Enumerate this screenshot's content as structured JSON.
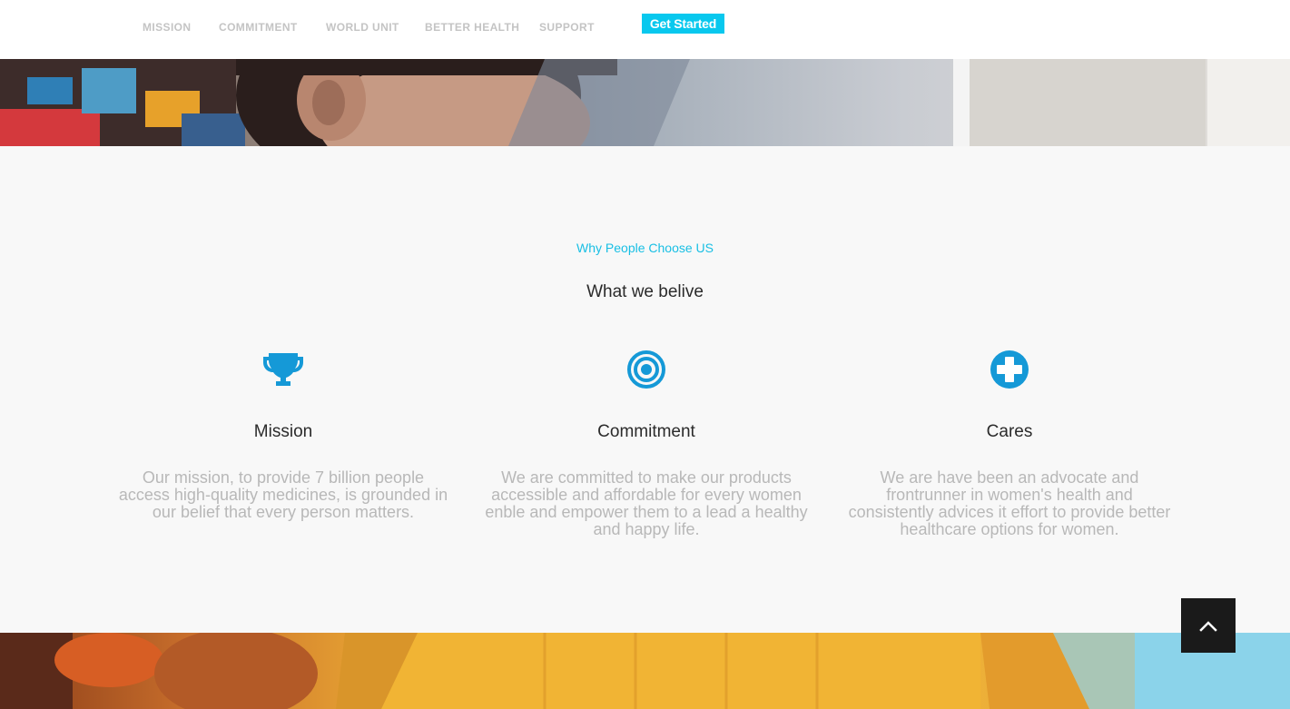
{
  "nav": {
    "items": [
      {
        "label": "MISSION"
      },
      {
        "label": "COMMITMENT"
      },
      {
        "label": "WORLD UNIT"
      },
      {
        "label": "BETTER HEALTH"
      },
      {
        "label": "SUPPORT"
      }
    ],
    "cta_label": "Get Started"
  },
  "section": {
    "eyebrow": "Why People Choose US",
    "heading": "What we belive",
    "features": [
      {
        "icon": "trophy-icon",
        "title": "Mission",
        "description": "Our mission, to provide 7 billion people access high-quality medicines, is grounded in our belief that every person matters."
      },
      {
        "icon": "target-icon",
        "title": "Commitment",
        "description": "We are committed to make our products accessible and affordable for every women enble and empower them to a lead a healthy and happy life."
      },
      {
        "icon": "plus-circle-icon",
        "title": "Cares",
        "description": "We are have been an advocate and frontrunner in women's health and consistently advices it effort to provide better healthcare options for women."
      }
    ]
  },
  "back_to_top": {
    "icon": "chevron-up-icon"
  },
  "colors": {
    "accent": "#08c8ee",
    "icon": "#1599d7",
    "muted_text": "#b8b8b8",
    "dark_button": "#1a1a1a"
  }
}
